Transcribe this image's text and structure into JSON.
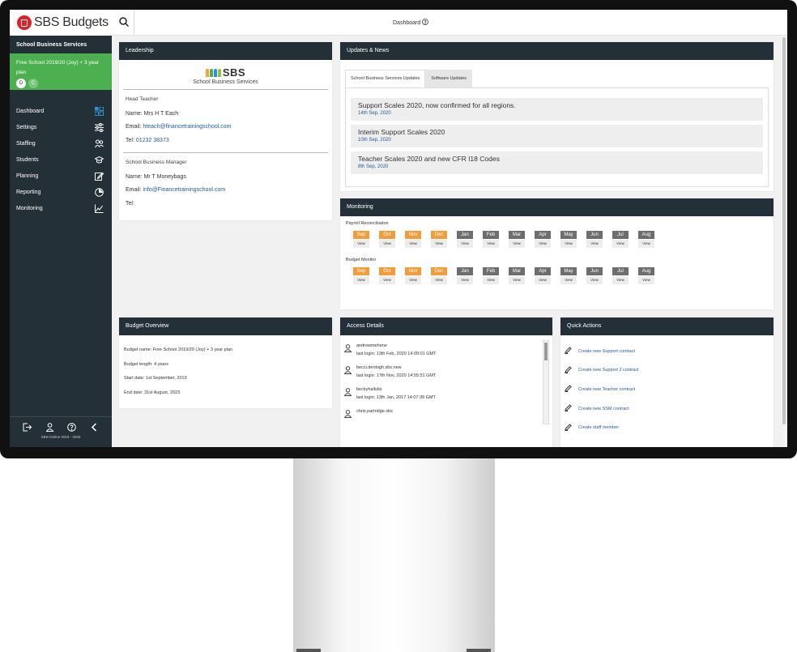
{
  "app": {
    "logo_text": "SBS Budgets",
    "org_name": "School Business Services",
    "plan_label": "Free School 2019/20 (Joy) + 3 year plan",
    "badges": [
      "D",
      "C"
    ]
  },
  "sidebar": {
    "items": [
      {
        "label": "Dashboard",
        "icon": "dashboard-grid-icon"
      },
      {
        "label": "Settings",
        "icon": "sliders-icon"
      },
      {
        "label": "Staffing",
        "icon": "people-icon"
      },
      {
        "label": "Students",
        "icon": "graduation-cap-icon"
      },
      {
        "label": "Planning",
        "icon": "edit-icon"
      },
      {
        "label": "Reporting",
        "icon": "pie-chart-icon"
      },
      {
        "label": "Monitoring",
        "icon": "line-chart-icon"
      }
    ],
    "footer_version": "SBS-Online 2019 - 2020"
  },
  "topbar": {
    "title": "Dashboard"
  },
  "leadership": {
    "header": "Leadership",
    "logo_text": "SBS",
    "logo_sub": "School Business Services",
    "head": {
      "role": "Head Teacher",
      "name_label": "Name:",
      "name": "Mrs H T Each",
      "email_label": "Email:",
      "email": "hteach@financetrainingschool.com",
      "tel_label": "Tel:",
      "tel": "01232 38373"
    },
    "manager": {
      "role": "School Business Manager",
      "name_label": "Name:",
      "name": "Mr T Moneybags",
      "email_label": "Email:",
      "email": "info@Financetrainingschool.com",
      "tel_label": "Tel:"
    }
  },
  "updates": {
    "header": "Updates & News",
    "tabs": [
      "School Business Services Updates",
      "Software Updates"
    ],
    "items": [
      {
        "title": "Support Scales 2020, now confirmed for all regions.",
        "date": "14th Sep, 2020"
      },
      {
        "title": "Interim Support Scales 2020",
        "date": "10th Sep, 2020"
      },
      {
        "title": "Teacher Scales 2020 and new CFR I18 Codes",
        "date": "8th Sep, 2020"
      }
    ]
  },
  "monitoring": {
    "header": "Monitoring",
    "payroll_label": "Payroll Reconciliation",
    "budget_label": "Budget Monitor",
    "view_label": "View",
    "months": [
      "Sep",
      "Oct",
      "Nov",
      "Dec",
      "Jan",
      "Feb",
      "Mar",
      "Apr",
      "May",
      "Jun",
      "Jul",
      "Aug"
    ],
    "highlight_color": "#f39c3c",
    "normal_color": "#6d6d6d"
  },
  "budget": {
    "header": "Budget Overview",
    "lines": [
      "Budget name: Free School 2019/20 (Joy) + 3 year plan",
      "Budget length: 4 years",
      "Start date: 1st September, 2019",
      "End date: 31st August, 2023"
    ]
  },
  "access": {
    "header": "Access Details",
    "entries": [
      {
        "user": "andrewmehene",
        "login": "last login: 13th Feb, 2020 14:09:01 GMT"
      },
      {
        "user": "becci.denbigh.sbs.new",
        "login": "last login: 17th Nov, 2020 14:55:51 GMT"
      },
      {
        "user": "beckyhallsbs",
        "login": "last login: 13th Jan, 2017 14:07:39 GMT"
      },
      {
        "user": "chris.partridge.sbs",
        "login": ""
      }
    ]
  },
  "quick": {
    "header": "Quick Actions",
    "items": [
      "Create new Support contract",
      "Create new Support 2 contract",
      "Create new Teacher contract",
      "Create new SSM contract",
      "Create staff member"
    ]
  },
  "colors": {
    "navy": "#243038",
    "green": "#4caf50",
    "brand_red": "#d8232a",
    "link": "#1e5b9a"
  }
}
